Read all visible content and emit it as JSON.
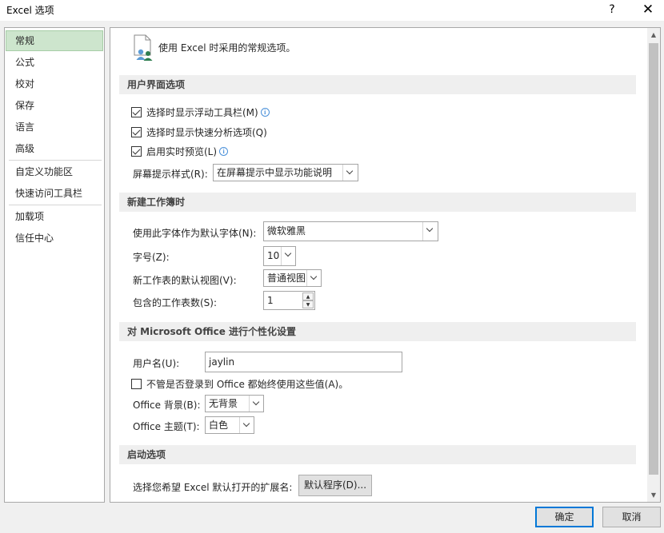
{
  "window": {
    "title": "Excel 选项",
    "help_label": "?",
    "close_label": "✕"
  },
  "sidebar": {
    "items": [
      {
        "label": "常规"
      },
      {
        "label": "公式"
      },
      {
        "label": "校对"
      },
      {
        "label": "保存"
      },
      {
        "label": "语言"
      },
      {
        "label": "高级"
      },
      {
        "label": "自定义功能区"
      },
      {
        "label": "快速访问工具栏"
      },
      {
        "label": "加载项"
      },
      {
        "label": "信任中心"
      }
    ],
    "selected_index": 0
  },
  "general": {
    "heading": "使用 Excel 时采用的常规选项。",
    "ui_section": {
      "title": "用户界面选项",
      "mini_toolbar_label": "选择时显示浮动工具栏(M)",
      "quick_analysis_label": "选择时显示快速分析选项(Q)",
      "live_preview_label": "启用实时预览(L)",
      "screentip_label": "屏幕提示样式(R):",
      "screentip_value": "在屏幕提示中显示功能说明",
      "info_glyph": "i"
    },
    "new_workbook_section": {
      "title": "新建工作簿时",
      "font_label": "使用此字体作为默认字体(N):",
      "font_value": "微软雅黑",
      "size_label": "字号(Z):",
      "size_value": "10",
      "view_label": "新工作表的默认视图(V):",
      "view_value": "普通视图",
      "sheets_label": "包含的工作表数(S):",
      "sheets_value": "1"
    },
    "personalize_section": {
      "title": "对 Microsoft Office 进行个性化设置",
      "username_label": "用户名(U):",
      "username_value": "jaylin",
      "always_use_label": "不管是否登录到 Office 都始终使用这些值(A)。",
      "background_label": "Office 背景(B):",
      "background_value": "无背景",
      "theme_label": "Office 主题(T):",
      "theme_value": "白色"
    },
    "startup_section": {
      "title": "启动选项",
      "extensions_label": "选择您希望 Excel 默认打开的扩展名:",
      "default_programs_button": "默认程序(D)..."
    }
  },
  "footer": {
    "ok_label": "确定",
    "cancel_label": "取消"
  },
  "colors": {
    "accent_blue": "#0078d7",
    "selected_nav_bg": "#cde5cd",
    "icon_green": "#2e7d4f"
  }
}
